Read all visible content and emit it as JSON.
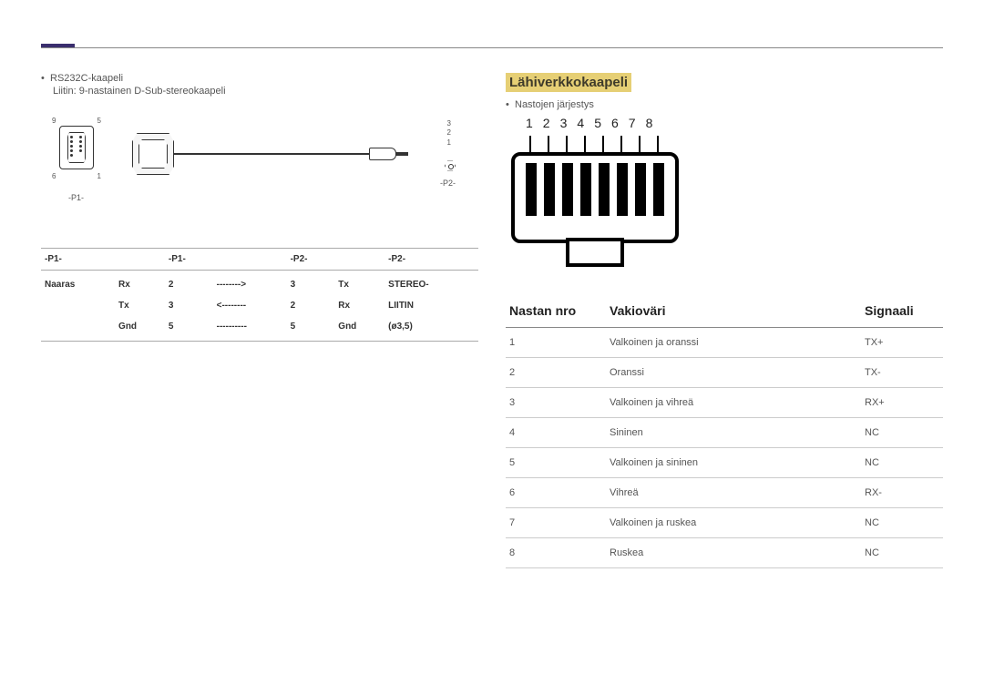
{
  "left": {
    "bullet1": "RS232C-kaapeli",
    "sub1": "Liitin: 9-nastainen D-Sub-stereokaapeli",
    "pins_top": {
      "tl": "9",
      "tr": "5",
      "bl": "6",
      "br": "1"
    },
    "rt_labels": {
      "a": "3",
      "b": "2",
      "c": "1"
    },
    "p1_tag": "-P1-",
    "p2_tag": "-P2-",
    "table": {
      "head": [
        "-P1-",
        "",
        "-P1-",
        "",
        "-P2-",
        "",
        "-P2-"
      ],
      "rows": [
        [
          "Naaras",
          "Rx",
          "2",
          "-------->",
          "3",
          "Tx",
          "STEREO-"
        ],
        [
          "",
          "Tx",
          "3",
          "<--------",
          "2",
          "Rx",
          "LIITIN"
        ],
        [
          "",
          "Gnd",
          "5",
          "----------",
          "5",
          "Gnd",
          "(ø3,5)"
        ]
      ]
    }
  },
  "right": {
    "title": "Lähiverkkokaapeli",
    "bullet1": "Nastojen järjestys",
    "nums": [
      "1",
      "2",
      "3",
      "4",
      "5",
      "6",
      "7",
      "8"
    ],
    "table": {
      "head": [
        "Nastan nro",
        "Vakioväri",
        "Signaali"
      ],
      "rows": [
        [
          "1",
          "Valkoinen ja oranssi",
          "TX+"
        ],
        [
          "2",
          "Oranssi",
          "TX-"
        ],
        [
          "3",
          "Valkoinen ja vihreä",
          "RX+"
        ],
        [
          "4",
          "Sininen",
          "NC"
        ],
        [
          "5",
          "Valkoinen ja sininen",
          "NC"
        ],
        [
          "6",
          "Vihreä",
          "RX-"
        ],
        [
          "7",
          "Valkoinen ja ruskea",
          "NC"
        ],
        [
          "8",
          "Ruskea",
          "NC"
        ]
      ]
    }
  }
}
